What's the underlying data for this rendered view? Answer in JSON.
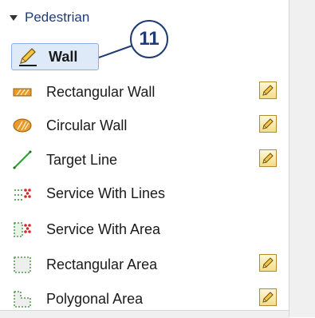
{
  "palette": {
    "section_label": "Pedestrian",
    "items": [
      {
        "label": "Wall",
        "icon": "pencil-icon",
        "selected": true,
        "has_edit": false
      },
      {
        "label": "Rectangular Wall",
        "icon": "rectangular-wall-icon",
        "has_edit": true
      },
      {
        "label": "Circular Wall",
        "icon": "circular-wall-icon",
        "has_edit": true
      },
      {
        "label": "Target Line",
        "icon": "target-line-icon",
        "has_edit": true
      },
      {
        "label": "Service With Lines",
        "icon": "service-lines-icon",
        "has_edit": false
      },
      {
        "label": "Service With Area",
        "icon": "service-area-icon",
        "has_edit": false
      },
      {
        "label": "Rectangular Area",
        "icon": "rectangular-area-icon",
        "has_edit": true
      },
      {
        "label": "Polygonal Area",
        "icon": "polygonal-area-icon",
        "has_edit": true
      }
    ]
  },
  "callout": {
    "number": "11"
  },
  "colors": {
    "accent": "#1e3c76",
    "selection_bg": "#dfeaf9",
    "selection_border": "#89aee6",
    "header_text": "#1f3d78"
  }
}
